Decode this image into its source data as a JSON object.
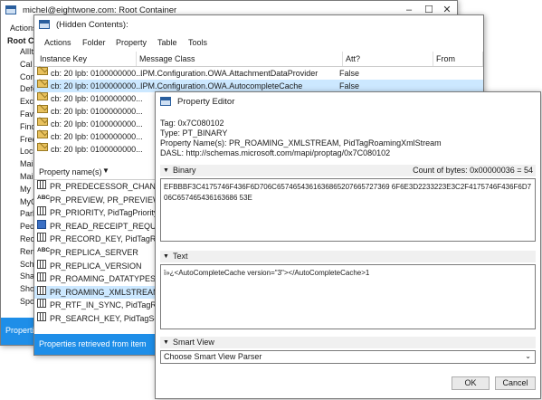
{
  "root_window": {
    "title": "michel@eightwone.com: Root Container",
    "menu": [
      "Actions"
    ],
    "tree_header": "Root Co",
    "tree_items": [
      "AllIt",
      "Cal",
      "Com",
      "Defe",
      "Exch",
      "Favo",
      "Find",
      "Free",
      "Loca",
      "Mail",
      "Mail",
      "My C",
      "MyC",
      "Park",
      "Peop",
      "Reco",
      "Rem",
      "Sche",
      "Shar",
      "Shor",
      "Spo"
    ],
    "status": "Properti"
  },
  "hidden_window": {
    "title": "(Hidden Contents):",
    "menu": [
      "Actions",
      "Folder",
      "Property",
      "Table",
      "Tools"
    ],
    "columns": [
      "Instance Key",
      "Message Class",
      "Att?",
      "From"
    ],
    "rows": [
      {
        "key": "cb: 20 lpb: 0100000000...",
        "class": "IPM.Configuration.OWA.AttachmentDataProvider",
        "att": "False"
      },
      {
        "key": "cb: 20 lpb: 0100000000...",
        "class": "IPM.Configuration.OWA.AutocompleteCache",
        "att": "False"
      },
      {
        "key": "cb: 20 lpb: 0100000000...",
        "class": "",
        "att": ""
      },
      {
        "key": "cb: 20 lpb: 0100000000...",
        "class": "",
        "att": ""
      },
      {
        "key": "cb: 20 lpb: 0100000000...",
        "class": "",
        "att": ""
      },
      {
        "key": "cb: 20 lpb: 0100000000...",
        "class": "",
        "att": ""
      },
      {
        "key": "cb: 20 lpb: 0100000000...",
        "class": "",
        "att": ""
      }
    ],
    "props_header": "Property name(s)",
    "props": [
      {
        "icon": "grid",
        "name": "PR_PREDECESSOR_CHANGE_"
      },
      {
        "icon": "abc",
        "name": "PR_PREVIEW, PR_PREVIEW_A"
      },
      {
        "icon": "grid",
        "name": "PR_PRIORITY, PidTagPriority"
      },
      {
        "icon": "blue",
        "name": "PR_READ_RECEIPT_REQUEST"
      },
      {
        "icon": "grid",
        "name": "PR_RECORD_KEY, PidTagRec"
      },
      {
        "icon": "abc",
        "name": "PR_REPLICA_SERVER"
      },
      {
        "icon": "grid",
        "name": "PR_REPLICA_VERSION"
      },
      {
        "icon": "grid",
        "name": "PR_ROAMING_DATATYPES,"
      },
      {
        "icon": "grid",
        "name": "PR_ROAMING_XMLSTREAM,"
      },
      {
        "icon": "grid",
        "name": "PR_RTF_IN_SYNC, PidTagRtf"
      },
      {
        "icon": "grid",
        "name": "PR_SEARCH_KEY, PidTagSea"
      }
    ],
    "status": "Properties retrieved from item"
  },
  "editor": {
    "title": "Property Editor",
    "tag": "Tag: 0x7C080102",
    "type": "Type: PT_BINARY",
    "names": "Property Name(s): PR_ROAMING_XMLSTREAM, PidTagRoamingXmlStream",
    "dasl": "DASL: http://schemas.microsoft.com/mapi/proptag/0x7C080102",
    "binary_label": "Binary",
    "count_label": "Count of bytes: 0x00000036 = 54",
    "binary_value": "EFBBBF3C4175746F436F6D706C6574654361636865207665727369 6F6E3D2233223E3C2F4175746F436F6D706C657465436163686 53E",
    "text_label": "Text",
    "text_value": "ï»¿<AutoCompleteCache version=\"3\"></AutoCompleteCache>1",
    "smart_label": "Smart View",
    "smart_select": "Choose Smart View Parser",
    "ok": "OK",
    "cancel": "Cancel"
  },
  "colors": {
    "selected_row": "#cce8ff",
    "status_blue": "#1e8ee8",
    "accent": "#2a5f9e"
  }
}
